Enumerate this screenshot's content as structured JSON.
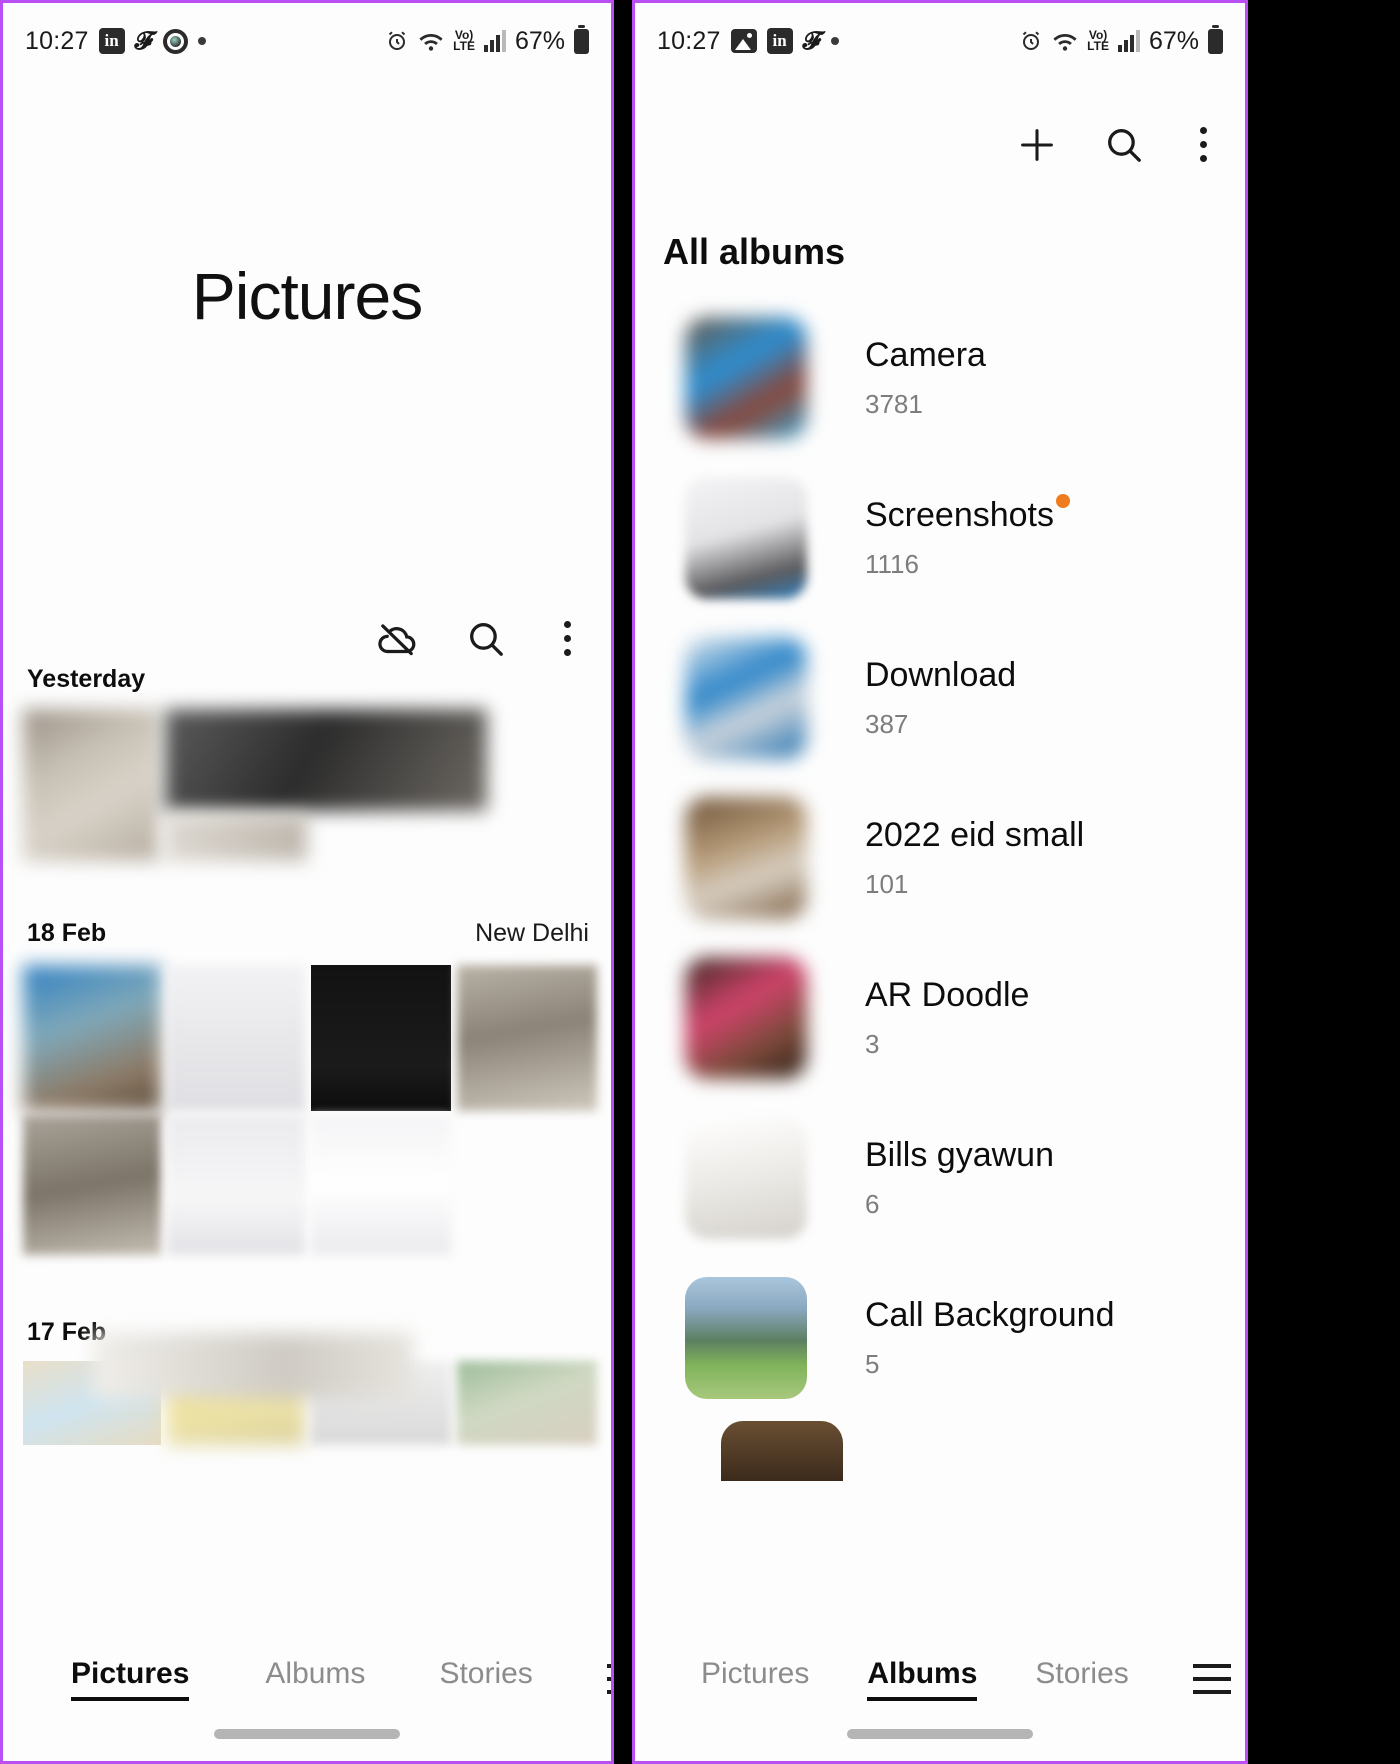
{
  "left_phone": {
    "status_bar": {
      "time": "10:27",
      "icons": [
        "linkedin-icon",
        "x-twitter-icon",
        "ring-app-icon",
        "dot-indicator"
      ],
      "right_icons": [
        "alarm-icon",
        "wifi-icon",
        "volte-icon",
        "signal-icon"
      ],
      "volte_top": "Vo)",
      "volte_bottom": "LTE",
      "battery": "67%"
    },
    "title": "Pictures",
    "toolbar": [
      {
        "name": "cloud-off-icon",
        "label": "cloud-off"
      },
      {
        "name": "search-icon",
        "label": "search"
      },
      {
        "name": "more-options-icon",
        "label": "more options"
      }
    ],
    "sections": [
      {
        "date": "Yesterday",
        "place": ""
      },
      {
        "date": "18 Feb",
        "place": "New Delhi"
      },
      {
        "date": "17 Feb",
        "place": ""
      }
    ],
    "bottom_nav": {
      "items": [
        {
          "label": "Pictures",
          "active": true
        },
        {
          "label": "Albums",
          "active": false
        },
        {
          "label": "Stories",
          "active": false
        }
      ],
      "menu_icon": "hamburger-menu-icon"
    }
  },
  "right_phone": {
    "status_bar": {
      "time": "10:27",
      "icons": [
        "gallery-image-icon",
        "linkedin-icon",
        "x-twitter-icon",
        "dot-indicator"
      ],
      "right_icons": [
        "alarm-icon",
        "wifi-icon",
        "volte-icon",
        "signal-icon"
      ],
      "volte_top": "Vo)",
      "volte_bottom": "LTE",
      "battery": "67%"
    },
    "toolbar": [
      {
        "name": "add-album-icon",
        "label": "add"
      },
      {
        "name": "search-icon",
        "label": "search"
      },
      {
        "name": "more-options-icon",
        "label": "more options"
      }
    ],
    "header": "All albums",
    "albums": [
      {
        "name": "Camera",
        "count": "3781",
        "badge": false
      },
      {
        "name": "Screenshots",
        "count": "1116",
        "badge": true
      },
      {
        "name": "Download",
        "count": "387",
        "badge": false
      },
      {
        "name": "2022 eid small",
        "count": "101",
        "badge": false
      },
      {
        "name": "AR Doodle",
        "count": "3",
        "badge": false
      },
      {
        "name": "Bills gyawun",
        "count": "6",
        "badge": false
      },
      {
        "name": "Call Background",
        "count": "5",
        "badge": false
      }
    ],
    "bottom_nav": {
      "items": [
        {
          "label": "Pictures",
          "active": false
        },
        {
          "label": "Albums",
          "active": true
        },
        {
          "label": "Stories",
          "active": false
        }
      ],
      "menu_icon": "hamburger-menu-icon"
    }
  },
  "colors": {
    "frame_accent": "#b94ff5",
    "badge_orange": "#f07c20",
    "text_primary": "#0d0d0d",
    "text_secondary": "#7d7d7d"
  }
}
